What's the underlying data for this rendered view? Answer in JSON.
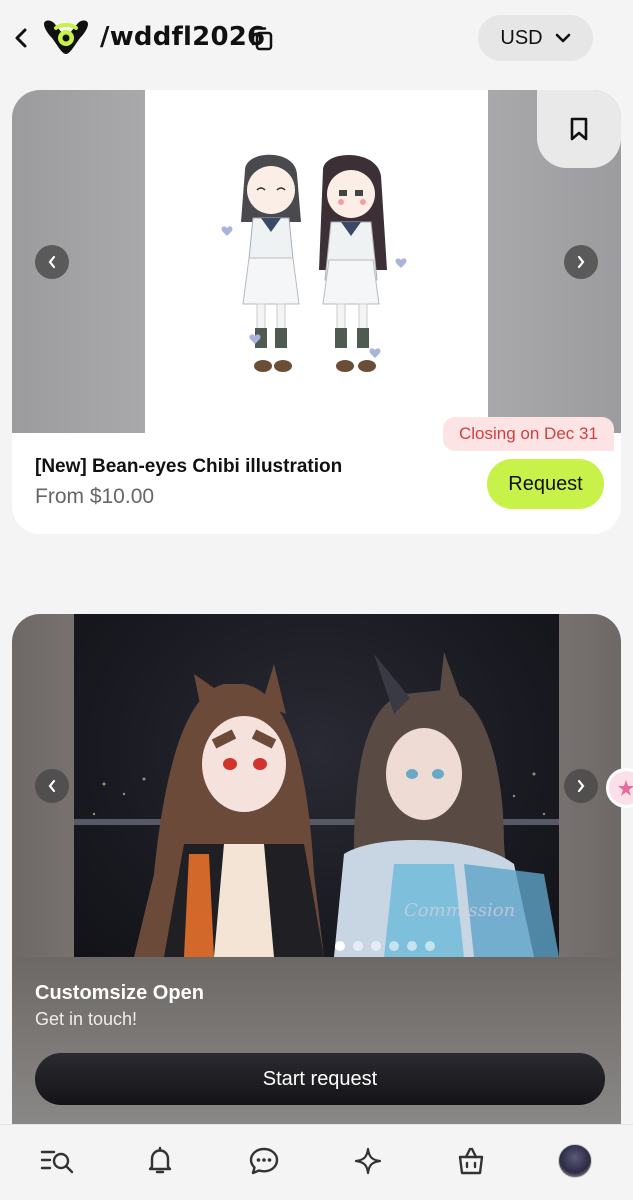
{
  "header": {
    "handle": "/wddfl2026",
    "currency": "USD",
    "icons": [
      "chevron-left-icon",
      "brand-logo",
      "copy-icon",
      "chevron-down-icon"
    ],
    "colors": {
      "brand": "#c8f24a",
      "logo_dark": "#111111"
    }
  },
  "card1": {
    "title": "[New] Bean-eyes Chibi illustration",
    "price": "From $10.00",
    "badge": "Closing on Dec 31",
    "button": "Request",
    "icons": [
      "bookmark-icon",
      "arrow-left-icon",
      "arrow-right-icon"
    ],
    "colors": {
      "badge_bg": "#fde4e4",
      "badge_text": "#d04040",
      "button_bg": "#c8f24a"
    }
  },
  "card2": {
    "title": "Customsize Open",
    "subtitle": "Get in touch!",
    "button": "Start request",
    "watermark": "Commission",
    "slides_total": 6,
    "active_slide": 1
  },
  "bottom_nav": {
    "items": [
      {
        "icon": "search-list-icon"
      },
      {
        "icon": "bell-icon"
      },
      {
        "icon": "chat-icon"
      },
      {
        "icon": "sparkle-icon"
      },
      {
        "icon": "shopping-bag-icon"
      },
      {
        "icon": "avatar"
      }
    ]
  }
}
